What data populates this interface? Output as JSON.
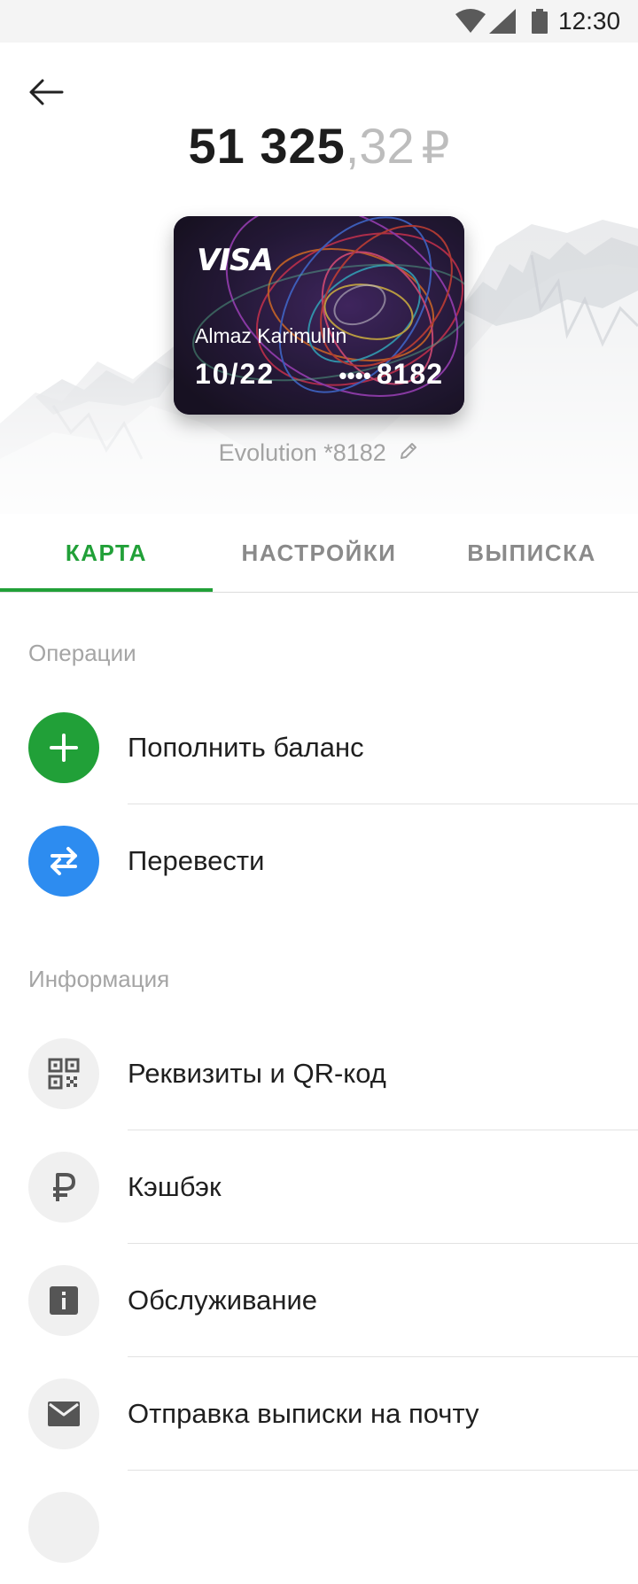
{
  "status_bar": {
    "time": "12:30",
    "icons": [
      "wifi-icon",
      "signal-icon",
      "battery-icon"
    ]
  },
  "header": {
    "back_icon": "arrow-left-icon",
    "balance_whole": "51 325",
    "balance_cents": ",32",
    "currency": "₽"
  },
  "card": {
    "brand": "VISA",
    "holder": "Almaz Karimullin",
    "expiry": "10/22",
    "masked_dots": "••••",
    "last_digits": "8182",
    "display_name": "Evolution *8182",
    "edit_icon": "pencil-icon"
  },
  "tabs": [
    {
      "label": "КАРТА",
      "active": true
    },
    {
      "label": "НАСТРОЙКИ",
      "active": false
    },
    {
      "label": "ВЫПИСКА",
      "active": false
    }
  ],
  "operations": {
    "title": "Операции",
    "items": [
      {
        "label": "Пополнить баланс",
        "icon": "plus-icon",
        "color": "#21a038"
      },
      {
        "label": "Перевести",
        "icon": "transfer-arrows-icon",
        "color": "#2d8cf0"
      }
    ]
  },
  "information": {
    "title": "Информация",
    "items": [
      {
        "label": "Реквизиты и QR-код",
        "icon": "qr-code-icon"
      },
      {
        "label": "Кэшбэк",
        "icon": "ruble-icon"
      },
      {
        "label": "Обслуживание",
        "icon": "info-icon"
      },
      {
        "label": "Отправка выписки на почту",
        "icon": "mail-icon"
      }
    ]
  },
  "colors": {
    "accent_green": "#21a038",
    "accent_blue": "#2d8cf0",
    "muted_text": "#a5a5a5"
  }
}
